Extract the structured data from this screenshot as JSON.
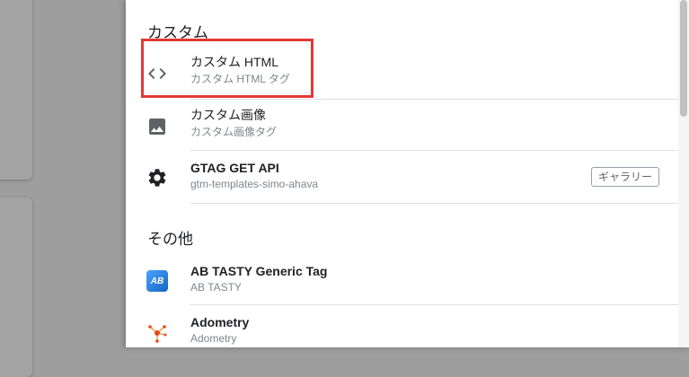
{
  "sections": {
    "custom": {
      "title": "カスタム"
    },
    "other": {
      "title": "その他"
    }
  },
  "items": {
    "custom_html": {
      "title": "カスタム HTML",
      "subtitle": "カスタム HTML タグ",
      "icon": "code-icon"
    },
    "custom_image": {
      "title": "カスタム画像",
      "subtitle": "カスタム画像タグ",
      "icon": "image-icon"
    },
    "gtag_get_api": {
      "title": "GTAG GET API",
      "subtitle": "gtm-templates-simo-ahava",
      "icon": "gear-icon",
      "badge": "ギャラリー"
    },
    "ab_tasty": {
      "title": "AB TASTY Generic Tag",
      "subtitle": "AB TASTY",
      "icon": "ab-tasty-logo-icon",
      "logo_text": "AB"
    },
    "adometry": {
      "title": "Adometry",
      "subtitle": "Adometry",
      "icon": "adometry-logo-icon"
    }
  },
  "colors": {
    "highlight": "#e53935",
    "ab_logo": "#1e88e5",
    "adometry_logo": "#e64a19"
  }
}
